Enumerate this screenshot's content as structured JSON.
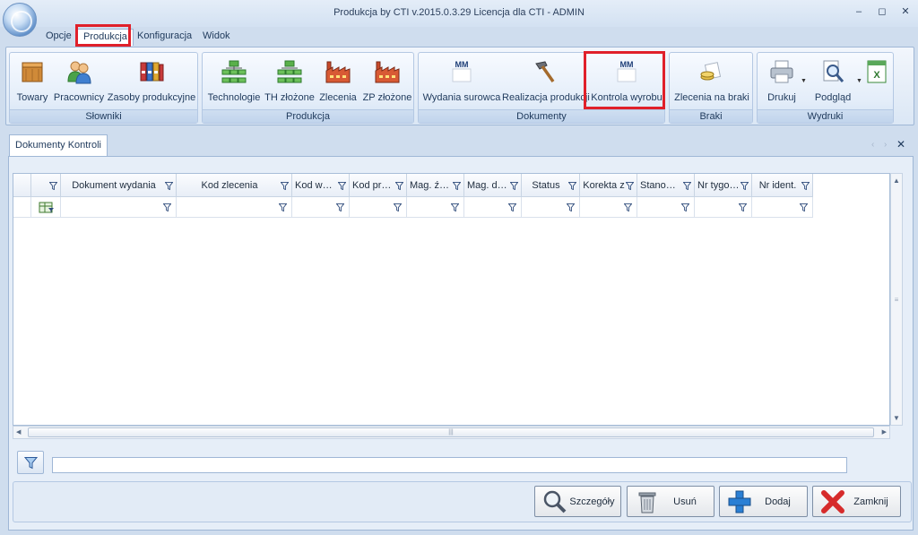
{
  "window": {
    "title": "Produkcja by CTI v.2015.0.3.29 Licencja dla CTI - ADMIN",
    "minimize_glyph": "‒",
    "maximize_glyph": "◻",
    "close_glyph": "✕"
  },
  "menu": {
    "tabs": [
      {
        "label": "Opcje"
      },
      {
        "label": "Produkcja",
        "active": true,
        "highlighted": true
      },
      {
        "label": "Konfiguracja"
      },
      {
        "label": "Widok"
      }
    ]
  },
  "ribbon": {
    "groups": [
      {
        "label": "Słowniki",
        "buttons": [
          {
            "label": "Towary",
            "icon": "crate-icon"
          },
          {
            "label": "Pracownicy",
            "icon": "people-icon"
          },
          {
            "label": "Zasoby produkcyjne",
            "icon": "binders-icon"
          }
        ]
      },
      {
        "label": "Produkcja",
        "buttons": [
          {
            "label": "Technologie",
            "icon": "hierarchy-icon"
          },
          {
            "label": "TH złożone",
            "icon": "hierarchy-complex-icon"
          },
          {
            "label": "Zlecenia",
            "icon": "factory-icon"
          },
          {
            "label": "ZP złożone",
            "icon": "factory-complex-icon"
          }
        ]
      },
      {
        "label": "Dokumenty",
        "buttons": [
          {
            "label": "Wydania surowca",
            "icon": "mm-document-icon",
            "icon_text": "MM"
          },
          {
            "label": "Realizacja produkcji",
            "icon": "hammer-icon"
          },
          {
            "label": "Kontrola wyrobu",
            "icon": "mm-document-icon",
            "icon_text": "MM",
            "highlighted": true
          }
        ]
      },
      {
        "label": "Braki",
        "buttons": [
          {
            "label": "Zlecenia na braki",
            "icon": "coins-icon"
          }
        ]
      },
      {
        "label": "Wydruki",
        "buttons": [
          {
            "label": "Drukuj",
            "icon": "printer-icon",
            "dropdown": true
          },
          {
            "label": "Podgląd",
            "icon": "preview-icon",
            "dropdown": true
          },
          {
            "label": "",
            "icon": "excel-export-icon"
          }
        ]
      }
    ]
  },
  "document_tab": {
    "label": "Dokumenty Kontroli",
    "nav_prev": "‹",
    "nav_next": "›",
    "close": "✕"
  },
  "grid": {
    "columns": [
      {
        "label": ""
      },
      {
        "label": "Dokument wydania"
      },
      {
        "label": "Kod zlecenia"
      },
      {
        "label": "Kod wyro..."
      },
      {
        "label": "Kod prac..."
      },
      {
        "label": "Mag. źró..."
      },
      {
        "label": "Mag. doc..."
      },
      {
        "label": "Status"
      },
      {
        "label": "Korekta z"
      },
      {
        "label": "Stanowis..."
      },
      {
        "label": "Nr tygod..."
      },
      {
        "label": "Nr ident."
      }
    ],
    "rows": [],
    "scroll_up": "▲",
    "scroll_down": "▼",
    "scroll_left": "◀",
    "scroll_right": "▶",
    "hscroll_grip": "|||",
    "vscroll_grip": "≡"
  },
  "filter": {
    "value": ""
  },
  "actions": {
    "details": "Szczegóły",
    "delete": "Usuń",
    "add": "Dodaj",
    "close": "Zamknij"
  },
  "colors": {
    "highlight": "#e0202a",
    "ribbon_text": "#1e395b",
    "add_blue": "#2a7fd4",
    "close_red": "#d62b2b"
  }
}
